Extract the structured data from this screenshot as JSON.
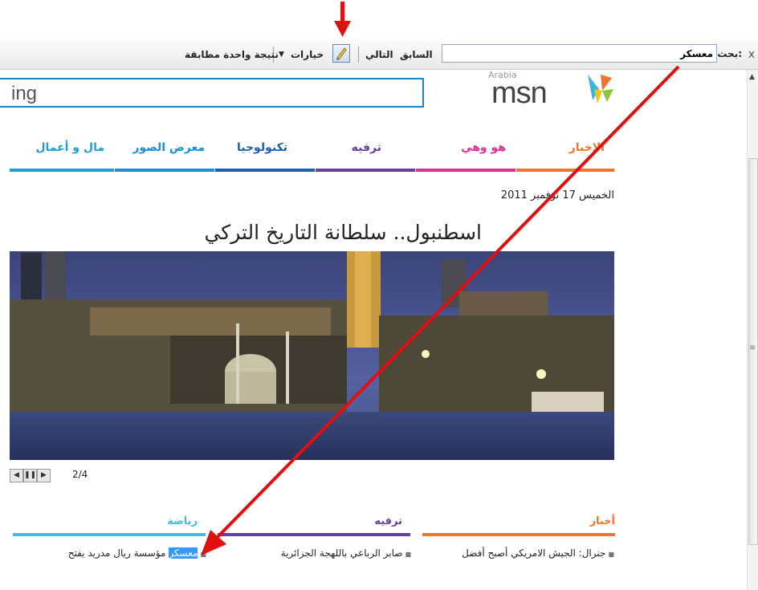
{
  "find_bar": {
    "close": "x",
    "label": "بحث:",
    "query": "معسكر",
    "prev": "السابق",
    "next": "التالي",
    "options": "خيارات",
    "status": "نتيجة واحدة مطابقة"
  },
  "header": {
    "bing": "ing",
    "msn": "msn",
    "arabia": "Arabia"
  },
  "nav": [
    {
      "label": "الاخبار",
      "color": "#f0752a"
    },
    {
      "label": "هو وهي",
      "color": "#d9318f"
    },
    {
      "label": "ترفيه",
      "color": "#6a3e9e"
    },
    {
      "label": "تكنولوجيا",
      "color": "#1d5fa8"
    },
    {
      "label": "معرض الصور",
      "color": "#1d8fd6"
    },
    {
      "label": "مال و أعمال",
      "color": "#1d9fd6"
    }
  ],
  "date": "الخميس 17 نوفمبر 2011",
  "headline": "اسطنبول.. سلطانة التاريخ التركي",
  "slider": {
    "count": "2/4"
  },
  "sections": [
    {
      "label": "أخبار",
      "color": "#f0752a"
    },
    {
      "label": "ترفيه",
      "color": "#6a3e9e"
    },
    {
      "label": "رياضة",
      "color": "#3cc0dc"
    }
  ],
  "stories": [
    {
      "text": "جنرال: الجيش الامريكي أصبح أفضل"
    },
    {
      "text": "صابر الرباعي باللهجة الجزائرية"
    },
    {
      "match": "معسكر",
      "rest": " مؤسسة ريال مدريد يفتح"
    }
  ]
}
